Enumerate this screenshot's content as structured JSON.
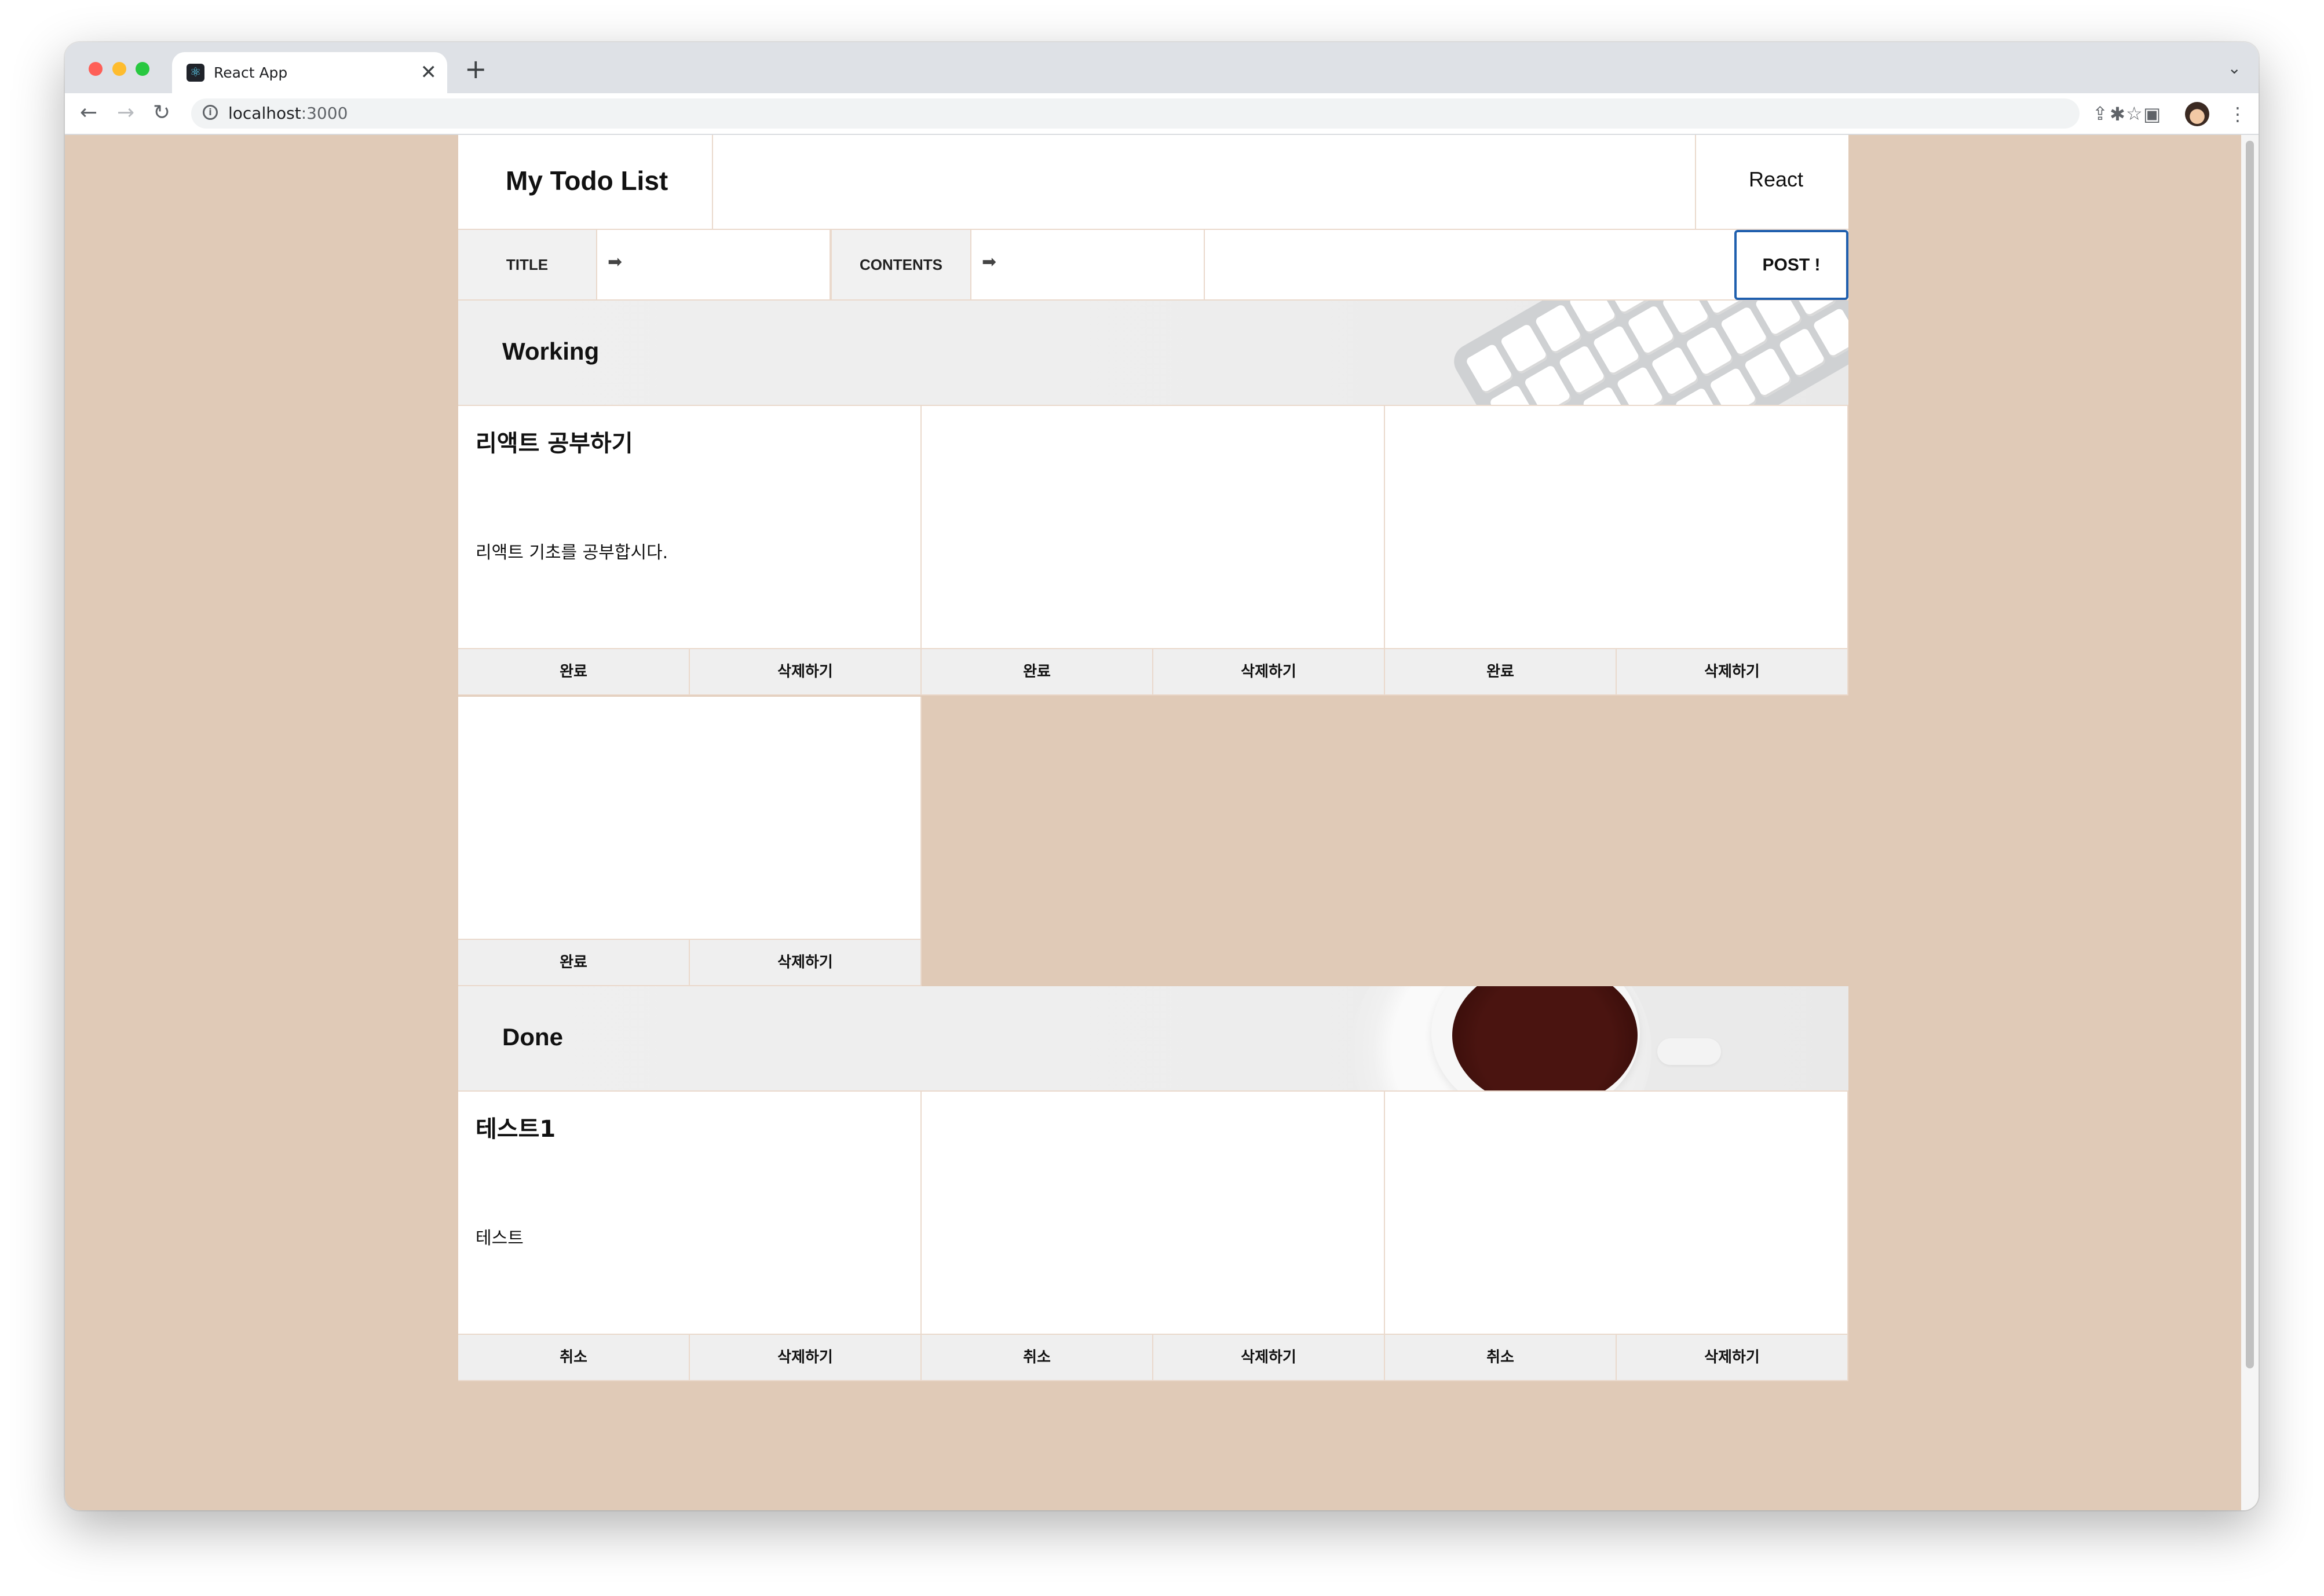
{
  "browser": {
    "tab_title": "React App",
    "tab_close": "✕",
    "new_tab": "+",
    "dropdown": "⌄",
    "url_host": "localhost",
    "url_port": ":3000",
    "icons": [
      "back-icon",
      "forward-icon",
      "reload-icon",
      "info-icon",
      "share-icon",
      "star-icon",
      "puzzle-icon",
      "side-panel-icon",
      "avatar",
      "menu-icon"
    ]
  },
  "header": {
    "title": "My Todo List",
    "tech": "React"
  },
  "form": {
    "title_label": "TITLE",
    "contents_label": "CONTENTS",
    "arrow": "➡",
    "title_value": "",
    "contents_value": "",
    "post_label": "POST !"
  },
  "working": {
    "heading": "Working",
    "cards": [
      {
        "title": "리액트 공부하기",
        "content": "리액트 기초를 공부합시다.",
        "toggle": "완료",
        "delete": "삭제하기"
      },
      {
        "title": "",
        "content": "",
        "toggle": "완료",
        "delete": "삭제하기"
      },
      {
        "title": "",
        "content": "",
        "toggle": "완료",
        "delete": "삭제하기"
      },
      {
        "title": "",
        "content": "",
        "toggle": "완료",
        "delete": "삭제하기"
      }
    ]
  },
  "done": {
    "heading": "Done",
    "cards": [
      {
        "title": "테스트1",
        "content": "테스트",
        "toggle": "취소",
        "delete": "삭제하기"
      },
      {
        "title": "",
        "content": "",
        "toggle": "취소",
        "delete": "삭제하기"
      },
      {
        "title": "",
        "content": "",
        "toggle": "취소",
        "delete": "삭제하기"
      }
    ]
  },
  "colors": {
    "page_bg": "#e0cab7",
    "post_border": "#1f5fae",
    "button_bar": "#efefef"
  }
}
